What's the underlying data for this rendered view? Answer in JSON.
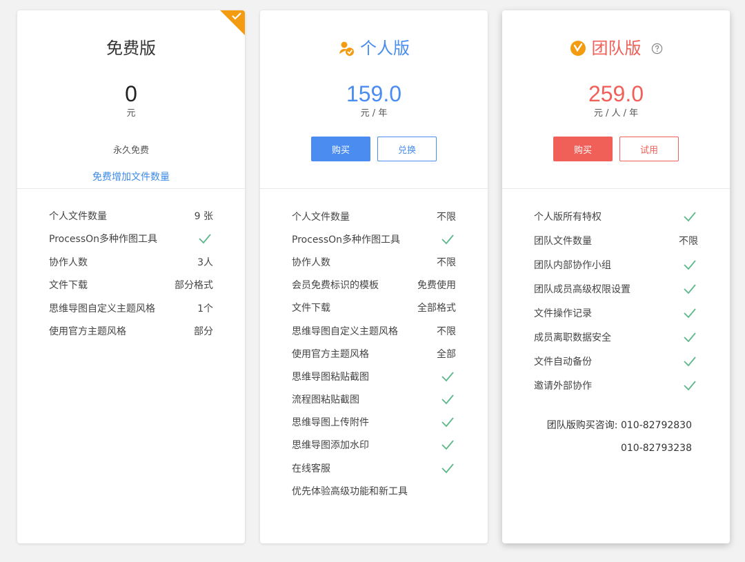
{
  "plans": {
    "free": {
      "title": "免费版",
      "price": "0",
      "unit": "元",
      "note": "永久免费",
      "link": "免费增加文件数量",
      "features": [
        {
          "label": "个人文件数量",
          "value": "9 张"
        },
        {
          "label": "ProcessOn多种作图工具",
          "value": null,
          "check": true
        },
        {
          "label": "协作人数",
          "value": "3人"
        },
        {
          "label": "文件下载",
          "value": "部分格式"
        },
        {
          "label": "思维导图自定义主题风格",
          "value": "1个"
        },
        {
          "label": "使用官方主题风格",
          "value": "部分"
        }
      ]
    },
    "personal": {
      "title": "个人版",
      "price": "159.0",
      "unit": "元 / 年",
      "buy_label": "购买",
      "redeem_label": "兑换",
      "features": [
        {
          "label": "个人文件数量",
          "value": "不限"
        },
        {
          "label": "ProcessOn多种作图工具",
          "value": null,
          "check": true
        },
        {
          "label": "协作人数",
          "value": "不限"
        },
        {
          "label": "会员免费标识的模板",
          "value": "免费使用"
        },
        {
          "label": "文件下载",
          "value": "全部格式"
        },
        {
          "label": "思维导图自定义主题风格",
          "value": "不限"
        },
        {
          "label": "使用官方主题风格",
          "value": "全部"
        },
        {
          "label": "思维导图粘贴截图",
          "value": null,
          "check": true
        },
        {
          "label": "流程图粘贴截图",
          "value": null,
          "check": true
        },
        {
          "label": "思维导图上传附件",
          "value": null,
          "check": true
        },
        {
          "label": "思维导图添加水印",
          "value": null,
          "check": true
        },
        {
          "label": "在线客服",
          "value": null,
          "check": true
        },
        {
          "label": "优先体验高级功能和新工具",
          "value": null
        }
      ]
    },
    "team": {
      "title": "团队版",
      "price": "259.0",
      "unit": "元 / 人 / 年",
      "buy_label": "购买",
      "trial_label": "试用",
      "features": [
        {
          "label": "个人版所有特权",
          "value": null,
          "check": true
        },
        {
          "label": "团队文件数量",
          "value": "不限"
        },
        {
          "label": "团队内部协作小组",
          "value": null,
          "check": true
        },
        {
          "label": "团队成员高级权限设置",
          "value": null,
          "check": true
        },
        {
          "label": "文件操作记录",
          "value": null,
          "check": true
        },
        {
          "label": "成员离职数据安全",
          "value": null,
          "check": true
        },
        {
          "label": "文件自动备份",
          "value": null,
          "check": true
        },
        {
          "label": "邀请外部协作",
          "value": null,
          "check": true
        }
      ],
      "contact_label": "团队版购买咨询:",
      "contact_phone_1": "010-82792830",
      "contact_phone_2": "010-82793238"
    }
  },
  "colors": {
    "blue": "#4a8cf0",
    "red": "#f06059",
    "orange": "#f39c12",
    "check_green": "#5cb88a"
  },
  "icons": {
    "corner": "corner-check-icon",
    "personal": "person-badge-icon",
    "team": "team-badge-icon",
    "help": "help-icon",
    "check": "check-icon"
  }
}
